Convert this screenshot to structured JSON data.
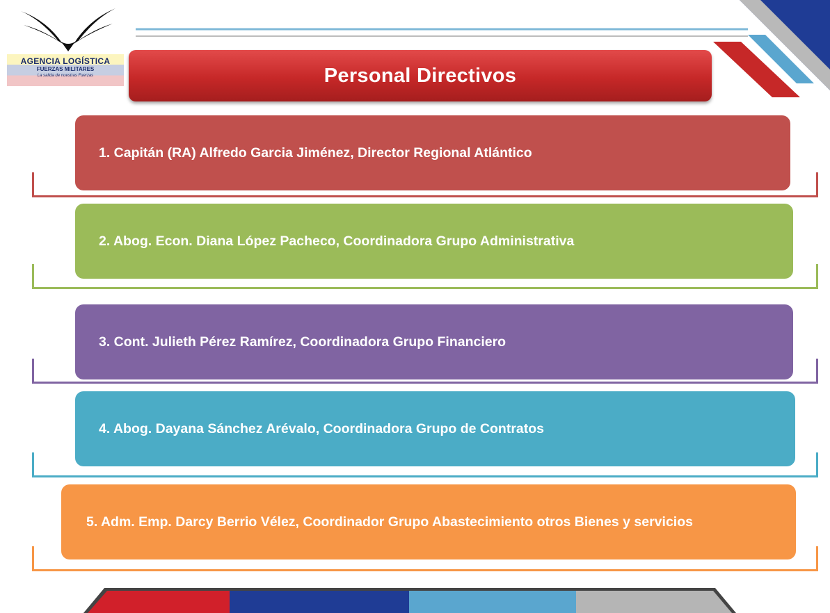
{
  "logo": {
    "line1": "AGENCIA LOGÍSTICA",
    "line2": "FUERZAS MILITARES",
    "line3": "La salida de nuestras Fuerzas"
  },
  "title": "Personal Directivos",
  "colors": {
    "title_red": "#c62828",
    "item1": "#c0504d",
    "item2": "#9bbb59",
    "item3": "#8064a2",
    "item4": "#4bacc6",
    "item5": "#f79646",
    "corner_blue": "#1f3c95"
  },
  "items": [
    {
      "text": "1. Capitán (RA) Alfredo Garcia Jiménez, Director Regional Atlántico"
    },
    {
      "text": "2. Abog. Econ. Diana López Pacheco, Coordinadora Grupo Administrativa"
    },
    {
      "text": "3. Cont. Julieth Pérez Ramírez, Coordinadora Grupo Financiero"
    },
    {
      "text": "4. Abog. Dayana Sánchez Arévalo,  Coordinadora Grupo de Contratos"
    },
    {
      "text": "5. Adm. Emp. Darcy  Berrio  Vélez, Coordinador Grupo Abastecimiento otros Bienes y servicios"
    }
  ]
}
